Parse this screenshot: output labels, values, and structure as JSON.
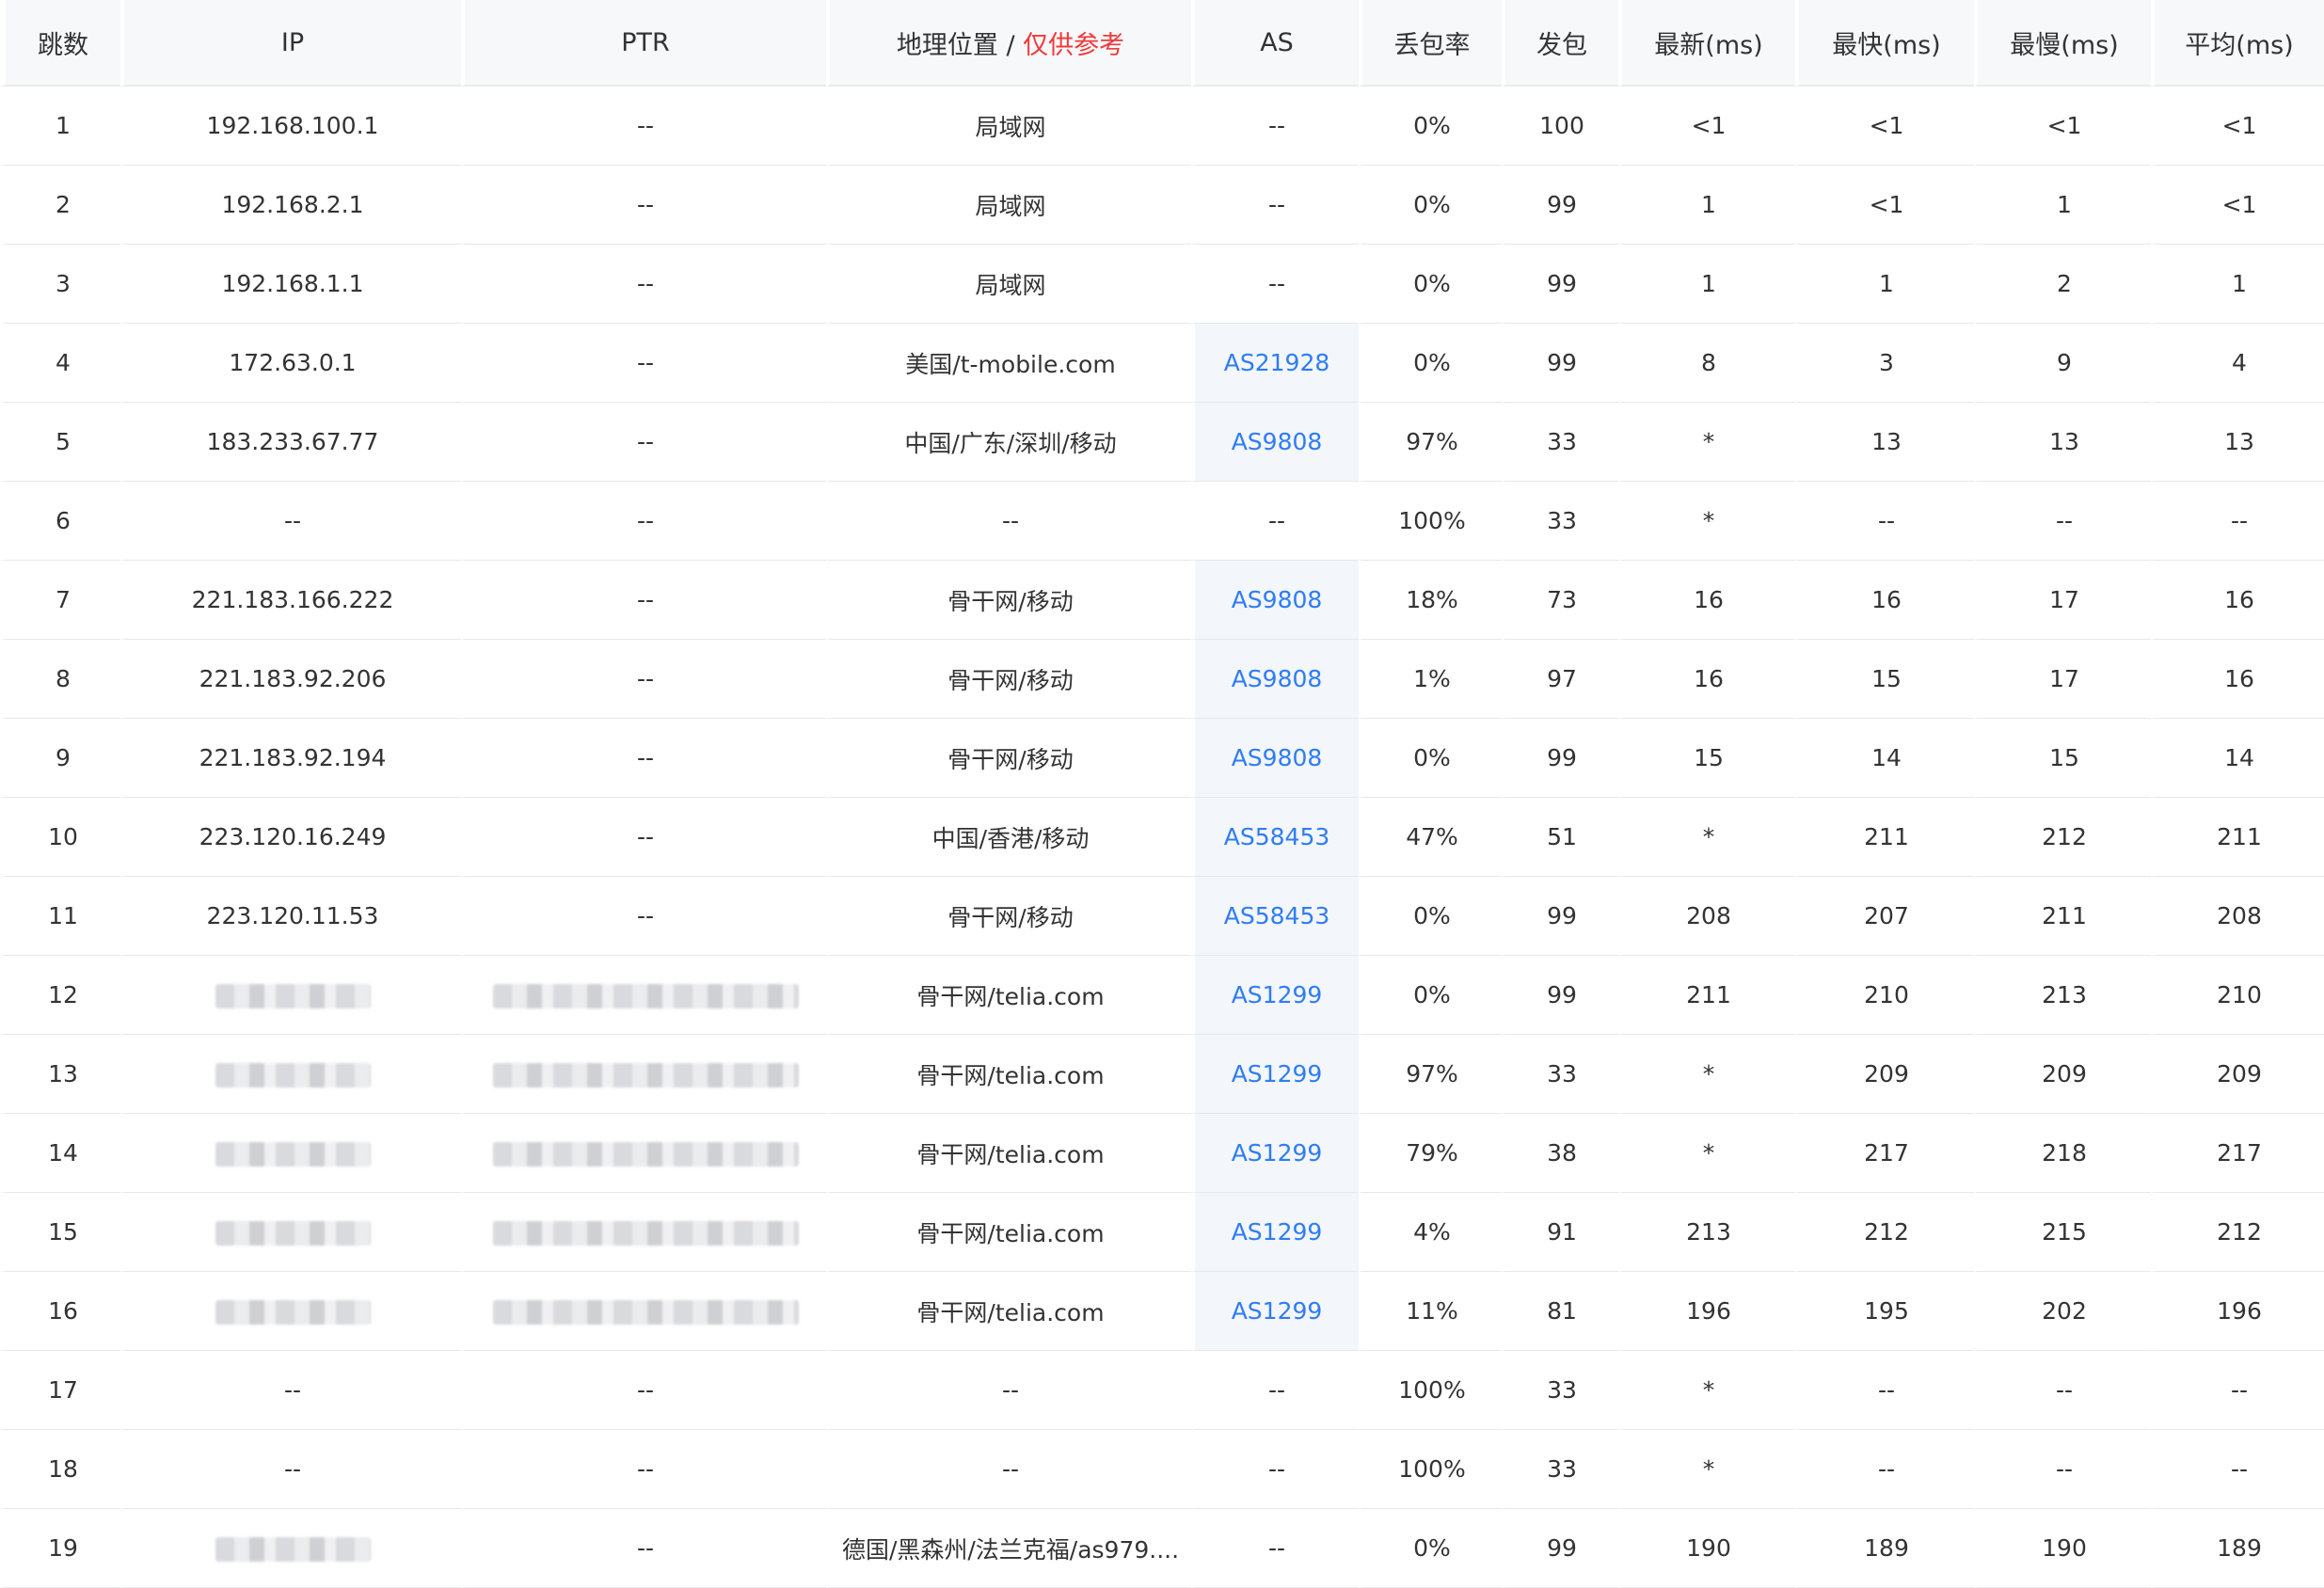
{
  "headers": {
    "hop": "跳数",
    "ip": "IP",
    "ptr": "PTR",
    "geo": "地理位置",
    "geo_separator": " / ",
    "geo_hint": "仅供参考",
    "as": "AS",
    "loss": "丢包率",
    "sent": "发包",
    "last": "最新(ms)",
    "best": "最快(ms)",
    "worst": "最慢(ms)",
    "avg": "平均(ms)"
  },
  "colors": {
    "hint": "#f03a3a",
    "as_link": "#2f7cf6"
  },
  "rows": [
    {
      "hop": "1",
      "ip": "192.168.100.1",
      "ptr": "--",
      "geo": "局域网",
      "as": "--",
      "loss": "0%",
      "sent": "100",
      "last": "<1",
      "best": "<1",
      "worst": "<1",
      "avg": "<1"
    },
    {
      "hop": "2",
      "ip": "192.168.2.1",
      "ptr": "--",
      "geo": "局域网",
      "as": "--",
      "loss": "0%",
      "sent": "99",
      "last": "1",
      "best": "<1",
      "worst": "1",
      "avg": "<1"
    },
    {
      "hop": "3",
      "ip": "192.168.1.1",
      "ptr": "--",
      "geo": "局域网",
      "as": "--",
      "loss": "0%",
      "sent": "99",
      "last": "1",
      "best": "1",
      "worst": "2",
      "avg": "1"
    },
    {
      "hop": "4",
      "ip": "172.63.0.1",
      "ptr": "--",
      "geo": "美国/t-mobile.com",
      "as": "AS21928",
      "loss": "0%",
      "sent": "99",
      "last": "8",
      "best": "3",
      "worst": "9",
      "avg": "4"
    },
    {
      "hop": "5",
      "ip": "183.233.67.77",
      "ptr": "--",
      "geo": "中国/广东/深圳/移动",
      "as": "AS9808",
      "loss": "97%",
      "sent": "33",
      "last": "*",
      "best": "13",
      "worst": "13",
      "avg": "13"
    },
    {
      "hop": "6",
      "ip": "--",
      "ptr": "--",
      "geo": "--",
      "as": "--",
      "loss": "100%",
      "sent": "33",
      "last": "*",
      "best": "--",
      "worst": "--",
      "avg": "--"
    },
    {
      "hop": "7",
      "ip": "221.183.166.222",
      "ptr": "--",
      "geo": "骨干网/移动",
      "as": "AS9808",
      "loss": "18%",
      "sent": "73",
      "last": "16",
      "best": "16",
      "worst": "17",
      "avg": "16"
    },
    {
      "hop": "8",
      "ip": "221.183.92.206",
      "ptr": "--",
      "geo": "骨干网/移动",
      "as": "AS9808",
      "loss": "1%",
      "sent": "97",
      "last": "16",
      "best": "15",
      "worst": "17",
      "avg": "16"
    },
    {
      "hop": "9",
      "ip": "221.183.92.194",
      "ptr": "--",
      "geo": "骨干网/移动",
      "as": "AS9808",
      "loss": "0%",
      "sent": "99",
      "last": "15",
      "best": "14",
      "worst": "15",
      "avg": "14"
    },
    {
      "hop": "10",
      "ip": "223.120.16.249",
      "ptr": "--",
      "geo": "中国/香港/移动",
      "as": "AS58453",
      "loss": "47%",
      "sent": "51",
      "last": "*",
      "best": "211",
      "worst": "212",
      "avg": "211"
    },
    {
      "hop": "11",
      "ip": "223.120.11.53",
      "ptr": "--",
      "geo": "骨干网/移动",
      "as": "AS58453",
      "loss": "0%",
      "sent": "99",
      "last": "208",
      "best": "207",
      "worst": "211",
      "avg": "208"
    },
    {
      "hop": "12",
      "ip": "",
      "ip_redacted": true,
      "ptr": "",
      "ptr_redacted": true,
      "geo": "骨干网/telia.com",
      "as": "AS1299",
      "loss": "0%",
      "sent": "99",
      "last": "211",
      "best": "210",
      "worst": "213",
      "avg": "210"
    },
    {
      "hop": "13",
      "ip": "",
      "ip_redacted": true,
      "ptr": "",
      "ptr_redacted": true,
      "geo": "骨干网/telia.com",
      "as": "AS1299",
      "loss": "97%",
      "sent": "33",
      "last": "*",
      "best": "209",
      "worst": "209",
      "avg": "209"
    },
    {
      "hop": "14",
      "ip": "",
      "ip_redacted": true,
      "ptr": "",
      "ptr_redacted": true,
      "geo": "骨干网/telia.com",
      "as": "AS1299",
      "loss": "79%",
      "sent": "38",
      "last": "*",
      "best": "217",
      "worst": "218",
      "avg": "217"
    },
    {
      "hop": "15",
      "ip": "",
      "ip_redacted": true,
      "ptr": "",
      "ptr_redacted": true,
      "geo": "骨干网/telia.com",
      "as": "AS1299",
      "loss": "4%",
      "sent": "91",
      "last": "213",
      "best": "212",
      "worst": "215",
      "avg": "212"
    },
    {
      "hop": "16",
      "ip": "",
      "ip_redacted": true,
      "ptr": "",
      "ptr_redacted": true,
      "geo": "骨干网/telia.com",
      "as": "AS1299",
      "loss": "11%",
      "sent": "81",
      "last": "196",
      "best": "195",
      "worst": "202",
      "avg": "196"
    },
    {
      "hop": "17",
      "ip": "--",
      "ptr": "--",
      "geo": "--",
      "as": "--",
      "loss": "100%",
      "sent": "33",
      "last": "*",
      "best": "--",
      "worst": "--",
      "avg": "--"
    },
    {
      "hop": "18",
      "ip": "--",
      "ptr": "--",
      "geo": "--",
      "as": "--",
      "loss": "100%",
      "sent": "33",
      "last": "*",
      "best": "--",
      "worst": "--",
      "avg": "--"
    },
    {
      "hop": "19",
      "ip": "",
      "ip_redacted": true,
      "ptr": "--",
      "geo": "德国/黑森州/法兰克福/as979....",
      "as": "--",
      "loss": "0%",
      "sent": "99",
      "last": "190",
      "best": "189",
      "worst": "190",
      "avg": "189"
    }
  ]
}
